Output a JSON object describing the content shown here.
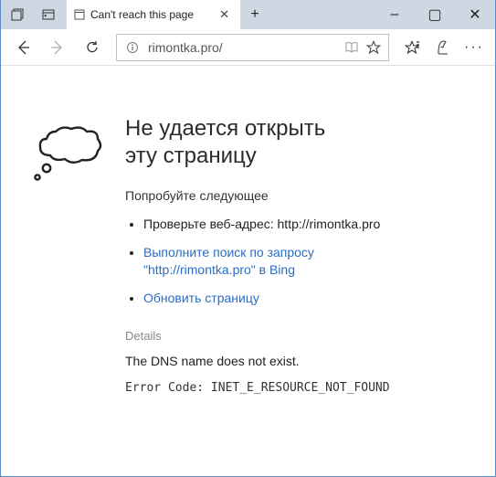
{
  "titlebar": {
    "tab": {
      "label": "Can't reach this page"
    },
    "newtab": "+"
  },
  "winctrl": {
    "min": "–",
    "max": "▢",
    "close": "✕"
  },
  "toolbar": {
    "url": "rimontka.pro/",
    "more": "···"
  },
  "error": {
    "title": "Не удается открыть эту страницу",
    "try_label": "Попробуйте следующее",
    "check_prefix": "Проверьте веб-адрес: ",
    "check_url": "http://rimontka.pro",
    "search_link": "Выполните поиск по запросу \"http://rimontka.pro\" в Bing",
    "refresh_link": "Обновить страницу",
    "details_label": "Details",
    "dns_msg": "The DNS name does not exist.",
    "code_label": "Error Code: ",
    "code_value": "INET_E_RESOURCE_NOT_FOUND"
  }
}
